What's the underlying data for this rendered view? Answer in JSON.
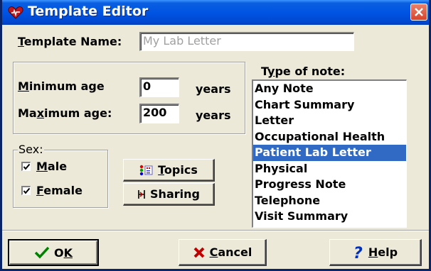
{
  "window": {
    "title": "Template Editor"
  },
  "template_name": {
    "label_prefix": "T",
    "label_rest": "emplate Name:",
    "value": "My Lab Letter"
  },
  "age": {
    "min_label_u": "M",
    "min_label_rest": "inimum age",
    "min_value": "0",
    "max_label_pre": "Ma",
    "max_label_u": "x",
    "max_label_rest": "imum age:",
    "max_value": "200",
    "unit": "years"
  },
  "sex": {
    "legend": "Sex:",
    "male_u": "M",
    "male_rest": "ale",
    "male_checked": true,
    "female_u": "F",
    "female_rest": "emale",
    "female_checked": true
  },
  "buttons": {
    "topics_u": "T",
    "topics_rest": "opics",
    "sharing": "Sharing",
    "ok_pre": "O",
    "ok_u": "K",
    "cancel_u": "C",
    "cancel_rest": "ancel",
    "help_u": "H",
    "help_rest": "elp"
  },
  "note_types": {
    "label_pre": "T",
    "label_u": "y",
    "label_rest": "pe of note:",
    "items": [
      "Any Note",
      "Chart Summary",
      "Letter",
      "Occupational Health",
      "Patient Lab Letter",
      "Physical",
      "Progress Note",
      "Telephone",
      "Visit Summary"
    ],
    "selected": "Patient Lab Letter"
  },
  "colors": {
    "title_bar": "#0054e3",
    "selection": "#316ac5",
    "face": "#ece9d8"
  },
  "icons": {
    "title": "heart-icon",
    "close": "close-icon",
    "topics": "topics-dots-icon",
    "sharing": "sharing-bracket-icon",
    "ok": "checkmark-icon",
    "cancel": "x-mark-icon",
    "help": "question-mark-icon"
  }
}
